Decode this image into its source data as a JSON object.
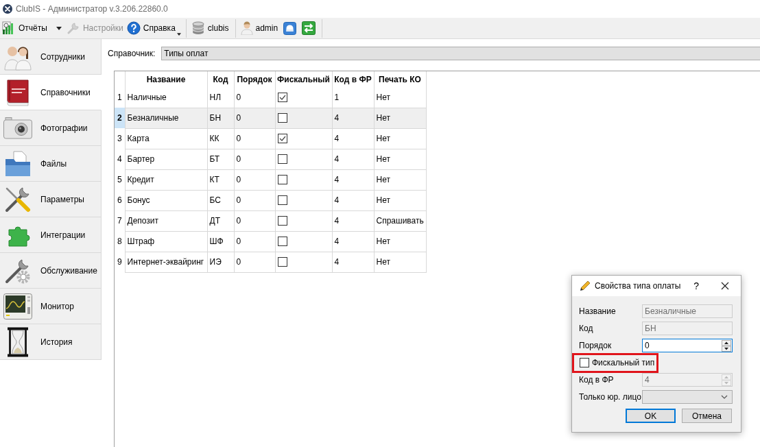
{
  "window": {
    "title": "ClubIS - Администратор v.3.206.22860.0"
  },
  "toolbar": {
    "groups": [
      {
        "items": [
          {
            "kind": "labeled",
            "label": "Отчёты",
            "disabled": false,
            "split_menu": true,
            "menu_caret": false
          },
          {
            "kind": "labeled",
            "label": "Настройки",
            "disabled": true,
            "split_menu": false,
            "menu_caret": false
          },
          {
            "kind": "labeled",
            "label": "Справка",
            "disabled": false,
            "split_menu": false,
            "menu_caret": true
          }
        ]
      },
      {
        "items": [
          {
            "kind": "labeled",
            "label": "clubis",
            "disabled": false,
            "split_menu": false,
            "menu_caret": false
          }
        ]
      },
      {
        "items": [
          {
            "kind": "labeled",
            "label": "admin",
            "disabled": false,
            "split_menu": false,
            "menu_caret": false
          },
          {
            "kind": "icon",
            "disabled": false,
            "split_menu": false,
            "menu_caret": false
          },
          {
            "kind": "icon",
            "disabled": false,
            "split_menu": false,
            "menu_caret": false
          }
        ]
      }
    ]
  },
  "sidebar": {
    "items": [
      {
        "label": "Сотрудники",
        "selected": false
      },
      {
        "label": "Справочники",
        "selected": true
      },
      {
        "label": "Фотографии",
        "selected": false
      },
      {
        "label": "Файлы",
        "selected": false
      },
      {
        "label": "Параметры",
        "selected": false
      },
      {
        "label": "Интеграции",
        "selected": false
      },
      {
        "label": "Обслуживание",
        "selected": false
      },
      {
        "label": "Монитор",
        "selected": false
      },
      {
        "label": "История",
        "selected": false
      }
    ]
  },
  "directory": {
    "label": "Справочник:",
    "value": "Типы оплат"
  },
  "table": {
    "columns": [
      "Название",
      "Код",
      "Порядок",
      "Фискальный",
      "Код в ФР",
      "Печать КО"
    ],
    "rows": [
      {
        "number": "1",
        "name": "Наличные",
        "code": "НЛ",
        "order": "0",
        "fiscal": true,
        "fr_code": "1",
        "receipt_print": "Нет",
        "selected": false
      },
      {
        "number": "2",
        "name": "Безналичные",
        "code": "БН",
        "order": "0",
        "fiscal": false,
        "fr_code": "4",
        "receipt_print": "Нет",
        "selected": true
      },
      {
        "number": "3",
        "name": "Карта",
        "code": "КК",
        "order": "0",
        "fiscal": true,
        "fr_code": "4",
        "receipt_print": "Нет",
        "selected": false
      },
      {
        "number": "4",
        "name": "Бартер",
        "code": "БТ",
        "order": "0",
        "fiscal": false,
        "fr_code": "4",
        "receipt_print": "Нет",
        "selected": false
      },
      {
        "number": "5",
        "name": "Кредит",
        "code": "КТ",
        "order": "0",
        "fiscal": false,
        "fr_code": "4",
        "receipt_print": "Нет",
        "selected": false
      },
      {
        "number": "6",
        "name": "Бонус",
        "code": "БС",
        "order": "0",
        "fiscal": false,
        "fr_code": "4",
        "receipt_print": "Нет",
        "selected": false
      },
      {
        "number": "7",
        "name": "Депозит",
        "code": "ДТ",
        "order": "0",
        "fiscal": false,
        "fr_code": "4",
        "receipt_print": "Спрашивать",
        "selected": false
      },
      {
        "number": "8",
        "name": "Штраф",
        "code": "ШФ",
        "order": "0",
        "fiscal": false,
        "fr_code": "4",
        "receipt_print": "Нет",
        "selected": false
      },
      {
        "number": "9",
        "name": "Интернет-эквайринг",
        "code": "ИЭ",
        "order": "0",
        "fiscal": false,
        "fr_code": "4",
        "receipt_print": "Нет",
        "selected": false
      }
    ]
  },
  "dialog": {
    "title": "Свойства типа оплаты",
    "help": "?",
    "fields": [
      {
        "kind": "text",
        "label": "Название",
        "value": "Безналичные",
        "disabled": true,
        "focused": false,
        "highlighted": false
      },
      {
        "kind": "text",
        "label": "Код",
        "value": "БН",
        "disabled": true,
        "focused": false,
        "highlighted": false
      },
      {
        "kind": "spin",
        "label": "Порядок",
        "value": "0",
        "disabled": false,
        "focused": true,
        "highlighted": false
      },
      {
        "kind": "checkbox",
        "label": "Фискальный тип",
        "checked": false,
        "disabled": false,
        "focused": false,
        "highlighted": true
      },
      {
        "kind": "spin",
        "label": "Код в ФР",
        "value": "4",
        "disabled": true,
        "focused": false,
        "highlighted": false
      },
      {
        "kind": "combo",
        "label": "Только юр. лицо",
        "disabled": false,
        "focused": false,
        "highlighted": false
      }
    ],
    "buttons": [
      {
        "label": "OK",
        "default": true
      },
      {
        "label": "Отмена",
        "default": false
      }
    ]
  }
}
